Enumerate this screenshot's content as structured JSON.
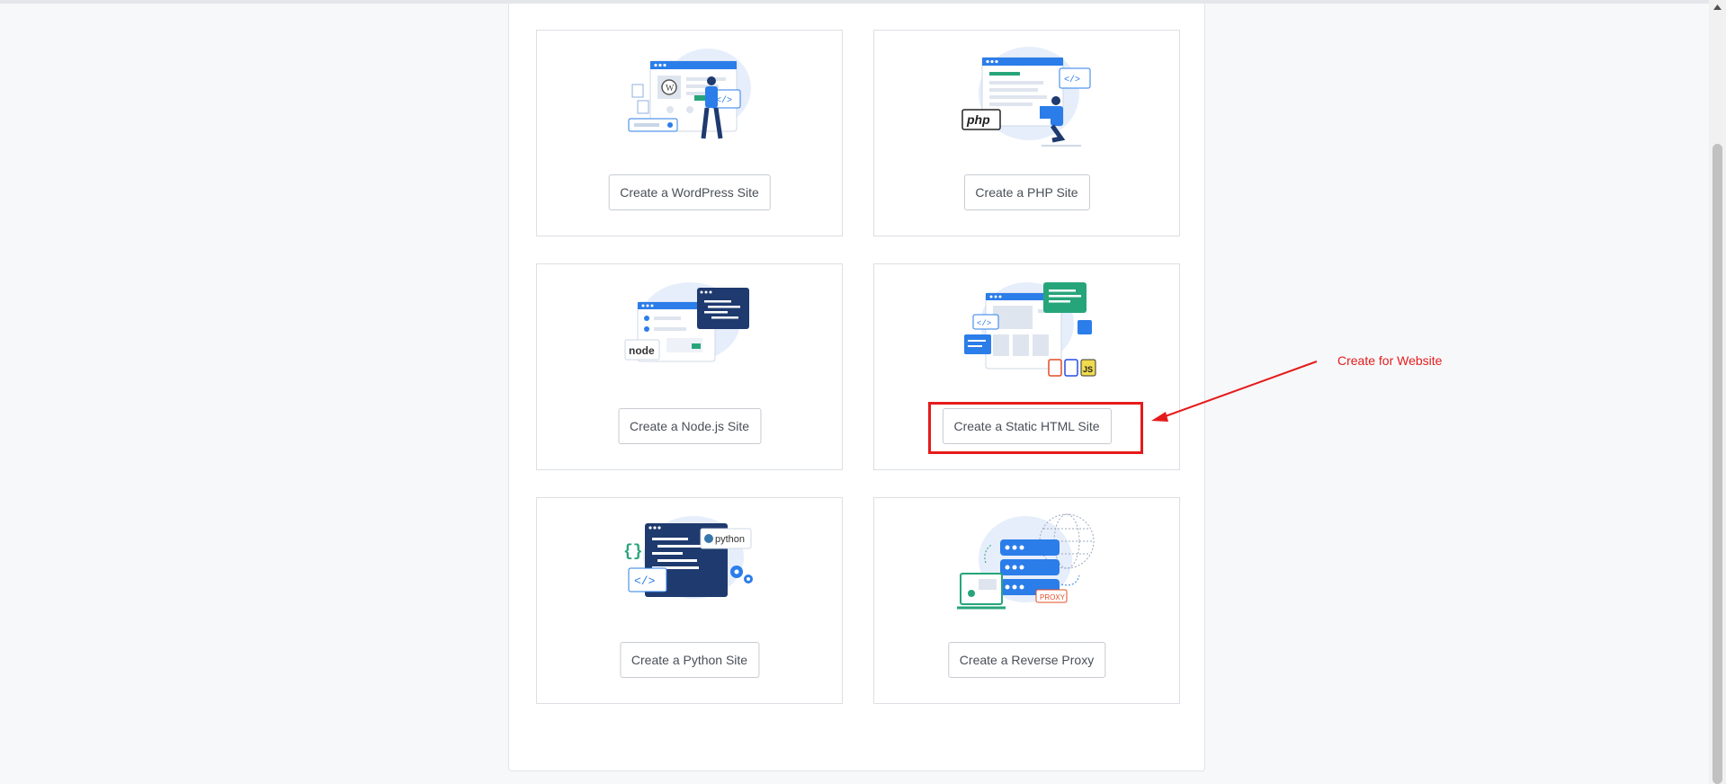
{
  "cards": [
    {
      "label": "Create a WordPress Site",
      "icon": "wordpress-site-illustration"
    },
    {
      "label": "Create a PHP Site",
      "icon": "php-site-illustration",
      "badge": "php"
    },
    {
      "label": "Create a Node.js Site",
      "icon": "nodejs-site-illustration",
      "badge": "node"
    },
    {
      "label": "Create a Static HTML Site",
      "icon": "static-html-site-illustration",
      "badges": [
        "JS"
      ]
    },
    {
      "label": "Create a Python Site",
      "icon": "python-site-illustration",
      "badge": "python"
    },
    {
      "label": "Create a Reverse Proxy",
      "icon": "reverse-proxy-illustration",
      "badge": "PROXY"
    }
  ],
  "annotation": {
    "text": "Create for Website",
    "color": "#e51b1b"
  },
  "colors": {
    "accent_blue": "#2b7de9",
    "navy": "#1e3a6e",
    "green": "#27a57a",
    "annotation_red": "#e51b1b"
  }
}
